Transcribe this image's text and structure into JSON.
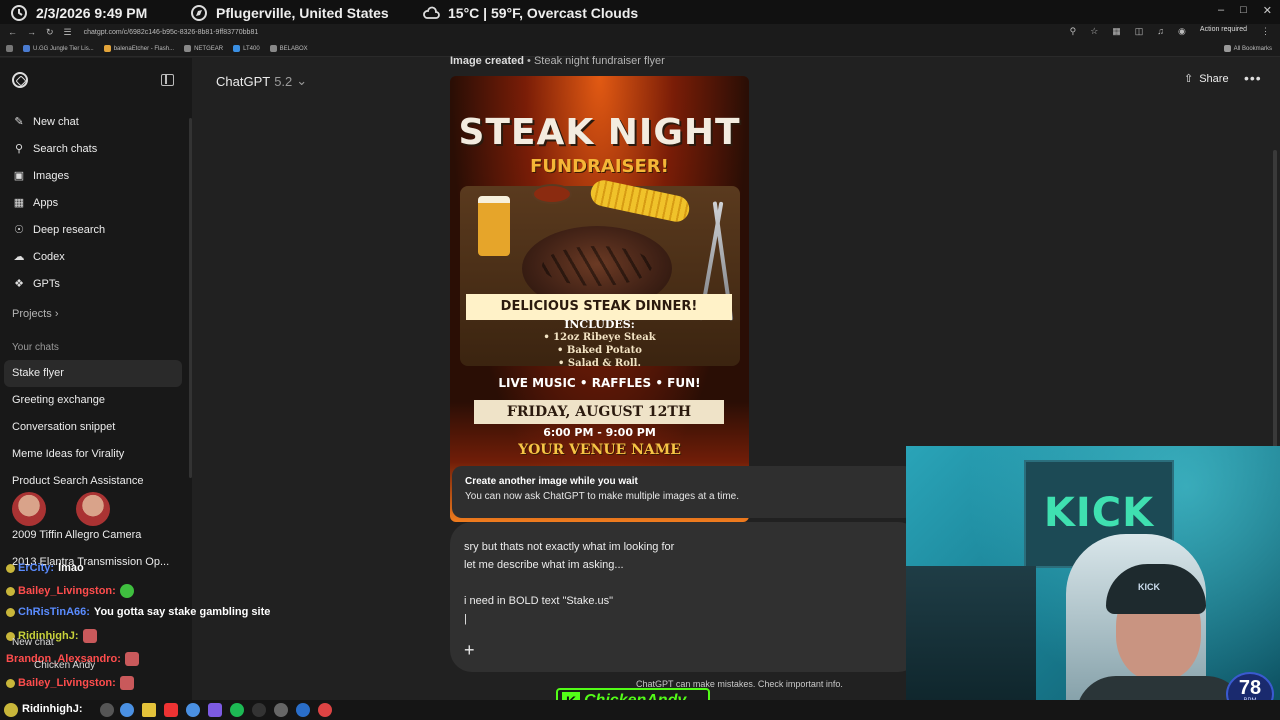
{
  "overlay": {
    "datetime": "2/3/2026 9:49 PM",
    "location": "Pflugerville, United States",
    "weather": "15°C | 59°F, Overcast Clouds"
  },
  "browser": {
    "url": "chatgpt.com/c/6982c146-b95c-8326-8b81-9ff83770bb81",
    "action_required": "Action required",
    "bookmarks": [
      "U.GG Jungle Tier Lis...",
      "balenaEtcher - Flash...",
      "NETGEAR",
      "LT400",
      "BELABOX"
    ],
    "all_bookmarks": "All Bookmarks"
  },
  "sidebar": {
    "menu": [
      {
        "label": "New chat",
        "icon": "edit-icon"
      },
      {
        "label": "Search chats",
        "icon": "search-icon"
      },
      {
        "label": "Images",
        "icon": "images-icon"
      },
      {
        "label": "Apps",
        "icon": "apps-icon"
      },
      {
        "label": "Deep research",
        "icon": "research-icon"
      },
      {
        "label": "Codex",
        "icon": "codex-icon"
      },
      {
        "label": "GPTs",
        "icon": "gpts-icon"
      }
    ],
    "projects_label": "Projects",
    "your_chats_label": "Your chats",
    "chats": [
      "Stake flyer",
      "Greeting exchange",
      "Conversation snippet",
      "Meme Ideas for Virality",
      "Product Search Assistance",
      "2009 Tiffin Allegro Camera",
      "2013 Elantra Transmission Op..."
    ]
  },
  "header": {
    "model_name": "ChatGPT",
    "model_version": "5.2",
    "share_label": "Share",
    "more_label": "•••"
  },
  "image_block": {
    "caption_prefix": "Image created",
    "caption_title": "• Steak night fundraiser flyer",
    "flyer": {
      "title": "STEAK NIGHT",
      "subtitle": "FUNDRAISER!",
      "banner": "DELICIOUS STEAK DINNER!",
      "includes_header": "INCLUDES:",
      "includes_items": [
        "• 12oz Ribeye Steak",
        "• Baked Potato",
        "• Salad & Roll."
      ],
      "extras": "LIVE MUSIC • RAFFLES • FUN!",
      "date": "FRIDAY, AUGUST 12TH",
      "time": "6:00 PM - 9:00 PM",
      "venue": "YOUR VENUE NAME"
    }
  },
  "toast": {
    "title": "Create another image while you wait",
    "body": "You can now ask ChatGPT to make multiple images at a time."
  },
  "composer": {
    "text": "sry but thats not exactly what im looking for\nlet me describe what im asking...\n\ni need in BOLD text \"Stake.us\"\n|",
    "plus_label": "+"
  },
  "footer_note": "ChatGPT can make mistakes. Check important info.",
  "stream_chat": [
    {
      "user": "ChRisTinA66:",
      "message": "You gotta say stake gambling site"
    },
    {
      "user": "RidinhighJ:",
      "message": ""
    },
    {
      "user": "Brandon_Alexsandro:",
      "message": ""
    },
    {
      "user": "Bailey_Livingston:",
      "message": ""
    },
    {
      "user": "Bailey_Livingston:",
      "message": ""
    },
    {
      "user": "RidinhighJ:",
      "message": ""
    }
  ],
  "stream_chat_extra": {
    "ercity": "ErCity:",
    "lmao": "lmao",
    "chicken_andy": "Chicken Andy",
    "new_chat": "New chat"
  },
  "webcam": {
    "kick_flag": "KICK",
    "beanie": "KICK",
    "bpm_value": "78",
    "bpm_unit": "BPM"
  },
  "kick_name": "ChickenAndy"
}
